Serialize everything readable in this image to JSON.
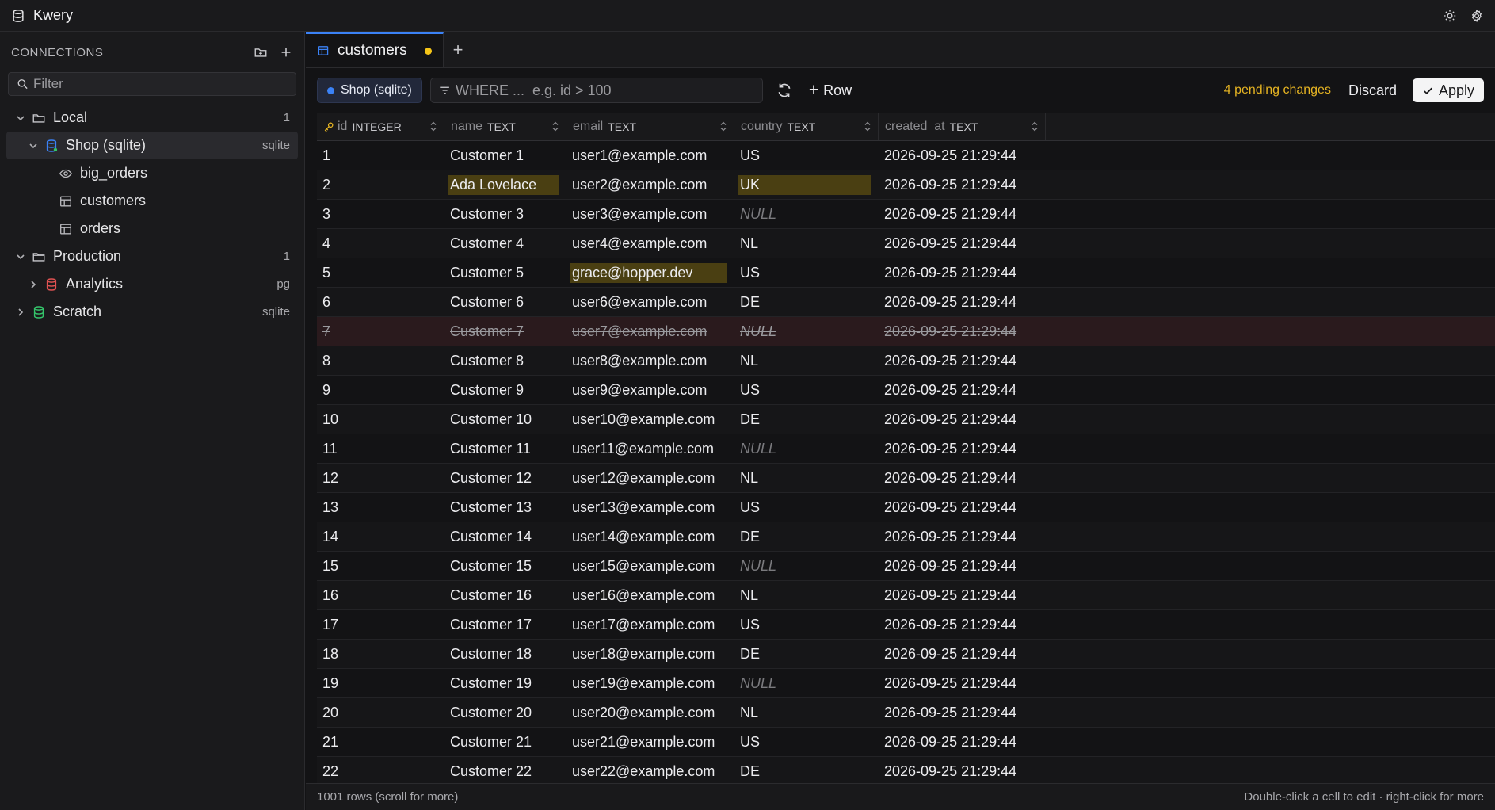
{
  "app": {
    "title": "Kwery"
  },
  "sidebar": {
    "header": "CONNECTIONS",
    "filter_placeholder": "Filter",
    "tree": [
      {
        "label": "Local",
        "meta": "1"
      },
      {
        "label": "Shop (sqlite)",
        "meta": "sqlite"
      },
      {
        "label": "big_orders",
        "meta": ""
      },
      {
        "label": "customers",
        "meta": ""
      },
      {
        "label": "orders",
        "meta": ""
      },
      {
        "label": "Production",
        "meta": "1"
      },
      {
        "label": "Analytics",
        "meta": "pg"
      },
      {
        "label": "Scratch",
        "meta": "sqlite"
      }
    ]
  },
  "tabs": {
    "active": "customers",
    "add": "+"
  },
  "toolbar": {
    "connection": "Shop (sqlite)",
    "where_placeholder": "WHERE ...  e.g. id > 100",
    "add_row": "Row",
    "pending": "4 pending changes",
    "discard": "Discard",
    "apply": "Apply"
  },
  "grid": {
    "columns": [
      {
        "name": "id",
        "type": "INTEGER"
      },
      {
        "name": "name",
        "type": "TEXT"
      },
      {
        "name": "email",
        "type": "TEXT"
      },
      {
        "name": "country",
        "type": "TEXT"
      },
      {
        "name": "created_at",
        "type": "TEXT"
      }
    ],
    "rows": [
      {
        "id": "1",
        "name": "Customer 1",
        "email": "user1@example.com",
        "country": "US",
        "created_at": "2026-09-25 21:29:44"
      },
      {
        "id": "2",
        "name": "Ada Lovelace",
        "email": "user2@example.com",
        "country": "UK",
        "created_at": "2026-09-25 21:29:44",
        "edited": [
          "name",
          "country"
        ]
      },
      {
        "id": "3",
        "name": "Customer 3",
        "email": "user3@example.com",
        "country": "NULL",
        "created_at": "2026-09-25 21:29:44"
      },
      {
        "id": "4",
        "name": "Customer 4",
        "email": "user4@example.com",
        "country": "NL",
        "created_at": "2026-09-25 21:29:44"
      },
      {
        "id": "5",
        "name": "Customer 5",
        "email": "grace@hopper.dev",
        "country": "US",
        "created_at": "2026-09-25 21:29:44",
        "edited": [
          "email"
        ]
      },
      {
        "id": "6",
        "name": "Customer 6",
        "email": "user6@example.com",
        "country": "DE",
        "created_at": "2026-09-25 21:29:44"
      },
      {
        "id": "7",
        "name": "Customer 7",
        "email": "user7@example.com",
        "country": "NULL",
        "created_at": "2026-09-25 21:29:44",
        "deleted": true
      },
      {
        "id": "8",
        "name": "Customer 8",
        "email": "user8@example.com",
        "country": "NL",
        "created_at": "2026-09-25 21:29:44"
      },
      {
        "id": "9",
        "name": "Customer 9",
        "email": "user9@example.com",
        "country": "US",
        "created_at": "2026-09-25 21:29:44"
      },
      {
        "id": "10",
        "name": "Customer 10",
        "email": "user10@example.com",
        "country": "DE",
        "created_at": "2026-09-25 21:29:44"
      },
      {
        "id": "11",
        "name": "Customer 11",
        "email": "user11@example.com",
        "country": "NULL",
        "created_at": "2026-09-25 21:29:44"
      },
      {
        "id": "12",
        "name": "Customer 12",
        "email": "user12@example.com",
        "country": "NL",
        "created_at": "2026-09-25 21:29:44"
      },
      {
        "id": "13",
        "name": "Customer 13",
        "email": "user13@example.com",
        "country": "US",
        "created_at": "2026-09-25 21:29:44"
      },
      {
        "id": "14",
        "name": "Customer 14",
        "email": "user14@example.com",
        "country": "DE",
        "created_at": "2026-09-25 21:29:44"
      },
      {
        "id": "15",
        "name": "Customer 15",
        "email": "user15@example.com",
        "country": "NULL",
        "created_at": "2026-09-25 21:29:44"
      },
      {
        "id": "16",
        "name": "Customer 16",
        "email": "user16@example.com",
        "country": "NL",
        "created_at": "2026-09-25 21:29:44"
      },
      {
        "id": "17",
        "name": "Customer 17",
        "email": "user17@example.com",
        "country": "US",
        "created_at": "2026-09-25 21:29:44"
      },
      {
        "id": "18",
        "name": "Customer 18",
        "email": "user18@example.com",
        "country": "DE",
        "created_at": "2026-09-25 21:29:44"
      },
      {
        "id": "19",
        "name": "Customer 19",
        "email": "user19@example.com",
        "country": "NULL",
        "created_at": "2026-09-25 21:29:44"
      },
      {
        "id": "20",
        "name": "Customer 20",
        "email": "user20@example.com",
        "country": "NL",
        "created_at": "2026-09-25 21:29:44"
      },
      {
        "id": "21",
        "name": "Customer 21",
        "email": "user21@example.com",
        "country": "US",
        "created_at": "2026-09-25 21:29:44"
      },
      {
        "id": "22",
        "name": "Customer 22",
        "email": "user22@example.com",
        "country": "DE",
        "created_at": "2026-09-25 21:29:44"
      }
    ]
  },
  "status": {
    "rows": "1001 rows (scroll for more)",
    "hint": "Double-click a cell to edit · right-click for more"
  },
  "colors": {
    "accent": "#3b82f6",
    "pending": "#e6b422",
    "edited_bg": "#4a3f12",
    "deleted_bg": "#2a1a1d",
    "analytics": "#e05252",
    "scratch": "#34c46a"
  },
  "icons": [
    "database-icon",
    "sun-icon",
    "gear-icon",
    "folder-plus-icon",
    "plus-icon",
    "search-icon",
    "chevron-down-icon",
    "chevron-right-icon",
    "folder-icon",
    "eye-icon",
    "table-icon",
    "filter-icon",
    "refresh-icon",
    "check-icon",
    "key-icon",
    "sort-icon"
  ]
}
